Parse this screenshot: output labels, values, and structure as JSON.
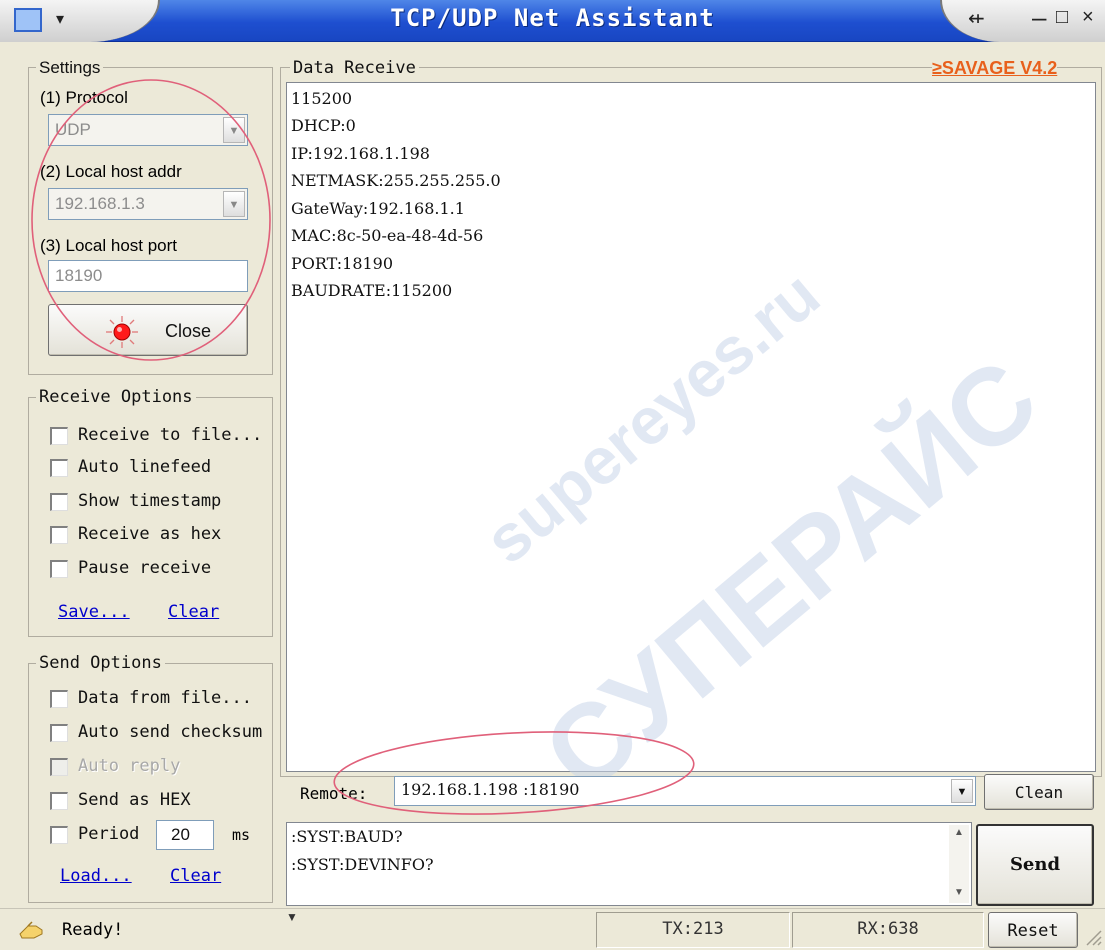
{
  "window": {
    "title": "TCP/UDP Net Assistant",
    "version_badge": "≥SAVAGE V4.2",
    "system_menu_arrow": "▾",
    "pin_glyph": "⇷",
    "minimize_glyph": "–",
    "maximize_glyph": "□",
    "close_glyph": "×"
  },
  "settings": {
    "group_title": "Settings",
    "protocol_label": "(1) Protocol",
    "protocol_value": "UDP",
    "local_addr_label": "(2) Local host addr",
    "local_addr_value": "192.168.1.3",
    "local_port_label": "(3) Local host port",
    "local_port_value": "18190",
    "close_button_label": "Close",
    "indicator_color": "#ff1a1a"
  },
  "receive_options": {
    "group_title": "Receive Options",
    "items": [
      {
        "label": "Receive to file...",
        "checked": false
      },
      {
        "label": "Auto linefeed",
        "checked": false
      },
      {
        "label": "Show timestamp",
        "checked": false
      },
      {
        "label": "Receive as hex",
        "checked": false
      },
      {
        "label": "Pause receive",
        "checked": false
      }
    ],
    "save_link": "Save...",
    "clear_link": "Clear"
  },
  "send_options": {
    "group_title": "Send Options",
    "items": [
      {
        "label": "Data from file...",
        "checked": false,
        "enabled": true
      },
      {
        "label": "Auto send checksum",
        "checked": false,
        "enabled": true
      },
      {
        "label": "Auto reply",
        "checked": false,
        "enabled": false
      },
      {
        "label": "Send as HEX",
        "checked": false,
        "enabled": true
      }
    ],
    "period_label": "Period",
    "period_value": "20",
    "period_unit": "ms",
    "load_link": "Load...",
    "clear_link": "Clear"
  },
  "data_receive": {
    "group_title": "Data Receive",
    "lines": [
      "115200",
      "DHCP:0",
      "IP:192.168.1.198",
      "NETMASK:255.255.255.0",
      "GateWay:192.168.1.1",
      "MAC:8c-50-ea-48-4d-56",
      "PORT:18190",
      "BAUDRATE:115200"
    ]
  },
  "remote": {
    "label": "Remote:",
    "value": "192.168.1.198 :18190",
    "clean_button": "Clean"
  },
  "send_box": {
    "lines": [
      ":SYST:BAUD?",
      ":SYST:DEVINFO?"
    ],
    "send_button": "Send"
  },
  "status_bar": {
    "status_text": "Ready!",
    "tx_label": "TX:213",
    "rx_label": "RX:638",
    "reset_button": "Reset"
  },
  "colors": {
    "titlebar_blue": "#1e4fd0",
    "highlight_ellipse": "#e0607a",
    "version_badge": "#e8601c",
    "link_blue": "#0000cc"
  }
}
